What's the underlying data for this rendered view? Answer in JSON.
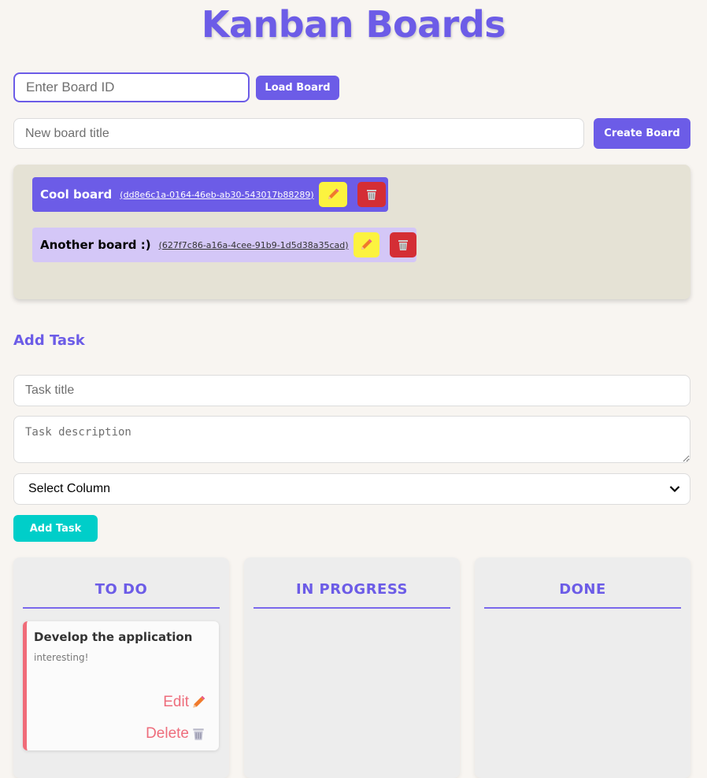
{
  "page": {
    "title": "Kanban Boards"
  },
  "board_loader": {
    "placeholder": "Enter Board ID",
    "button": "Load Board"
  },
  "board_creator": {
    "placeholder": "New board title",
    "button": "Create Board"
  },
  "boards": [
    {
      "name": "Cool board",
      "id_text": "(dd8e6c1a-0164-46eb-ab30-543017b88289)",
      "active": true
    },
    {
      "name": "Another board :)",
      "id_text": "(627f7c86-a16a-4cee-91b9-1d5d38a35cad)",
      "active": false
    }
  ],
  "task_form": {
    "heading": "Add Task",
    "title_placeholder": "Task title",
    "description_placeholder": "Task description",
    "column_select": "Select Column",
    "button": "Add Task"
  },
  "columns": [
    {
      "title": "TO DO",
      "tasks": [
        {
          "title": "Develop the application",
          "description": "interesting!",
          "edit_label": "Edit",
          "delete_label": "Delete"
        }
      ]
    },
    {
      "title": "IN PROGRESS",
      "tasks": []
    },
    {
      "title": "DONE",
      "tasks": []
    }
  ],
  "colors": {
    "accent": "#6c5ce7",
    "teal": "#00cec9",
    "edit_button": "#fcf33f",
    "delete_button": "#d42e35",
    "task_accent": "#f06b78",
    "panel": "#e5e2d5"
  },
  "icons": {
    "edit": "pencil-icon",
    "delete": "trash-icon",
    "select": "chevron-down-icon"
  }
}
